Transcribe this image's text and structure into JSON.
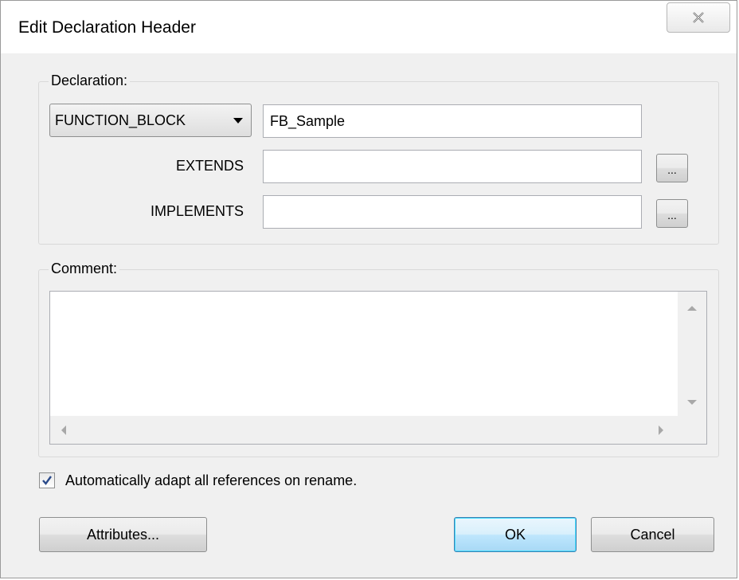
{
  "dialog": {
    "title": "Edit Declaration Header",
    "close_icon": "close-icon"
  },
  "declaration": {
    "group_label": "Declaration:",
    "kind_selected": "FUNCTION_BLOCK",
    "name_value": "FB_Sample",
    "extends_label": "EXTENDS",
    "extends_value": "",
    "extends_browse_label": "...",
    "implements_label": "IMPLEMENTS",
    "implements_value": "",
    "implements_browse_label": "..."
  },
  "comment": {
    "group_label": "Comment:",
    "value": ""
  },
  "options": {
    "adapt_references_label": "Automatically adapt all references on rename.",
    "adapt_references_checked": true
  },
  "buttons": {
    "attributes": "Attributes...",
    "ok": "OK",
    "cancel": "Cancel"
  }
}
